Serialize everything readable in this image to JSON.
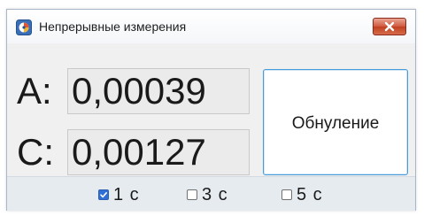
{
  "window": {
    "title": "Непрерывные измерения",
    "app_icon": "app-logo-icon",
    "close_icon": "close-icon"
  },
  "measurements": [
    {
      "label": "A:",
      "value": "0,00039"
    },
    {
      "label": "C:",
      "value": "0,00127"
    }
  ],
  "reset_button": {
    "label": "Обнуление"
  },
  "intervals": [
    {
      "label": "1 с",
      "checked": true
    },
    {
      "label": "3 с",
      "checked": false
    },
    {
      "label": "5 с",
      "checked": false
    }
  ],
  "colors": {
    "close_button": "#c9502f",
    "accent": "#2f6fd6",
    "button_border": "#4a9ad8"
  }
}
